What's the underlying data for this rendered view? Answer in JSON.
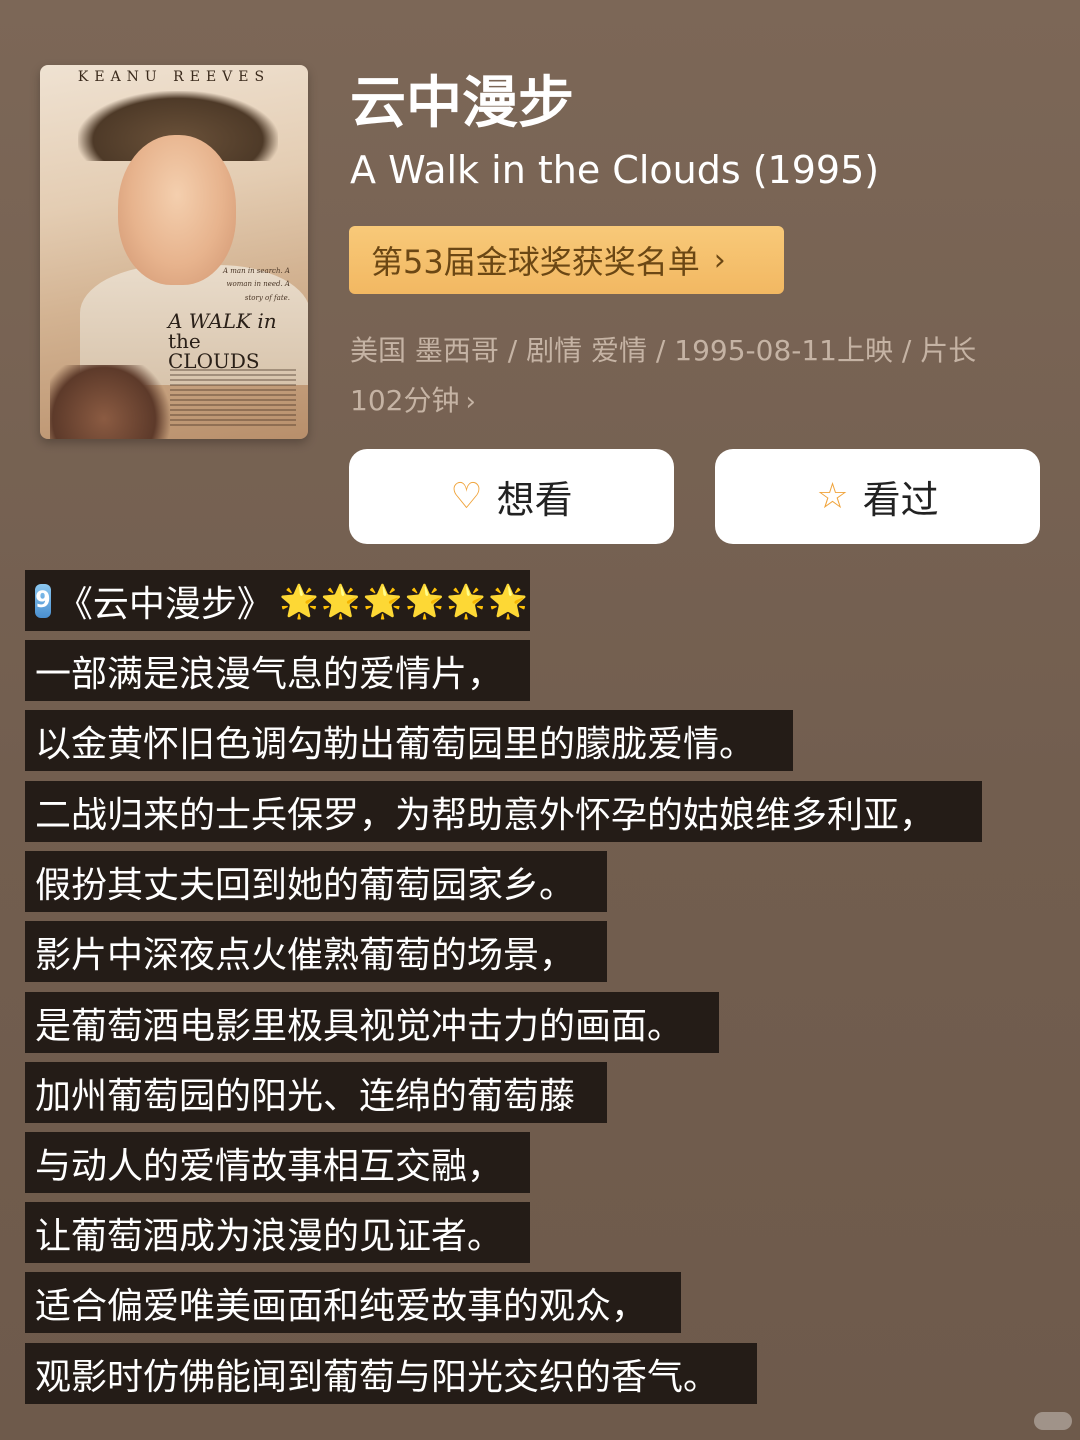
{
  "movie": {
    "poster": {
      "actor": "KEANU REEVES",
      "film_title_line1": "A WALK in",
      "film_title_line2": "the CLOUDS",
      "tagline": "A man in search. A woman in need. A story of fate."
    },
    "title_cn": "云中漫步",
    "title_en": "A Walk in the Clouds (1995)",
    "award": "第53届金球奖获奖名单",
    "meta_line1": "美国 墨西哥 / 剧情 爱情 / 1995-08-11上映 / 片长",
    "meta_line2": "102分钟",
    "buttons": {
      "want": "想看",
      "seen": "看过"
    },
    "icons": {
      "want": "heart-plus-icon",
      "seen": "star-outline-icon",
      "chevron": "chevron-right-icon"
    }
  },
  "review": {
    "number": "9",
    "headline": "《云中漫步》",
    "rating_stars": 6,
    "stars_text": "🌟🌟🌟🌟🌟🌟",
    "lines": [
      "一部满是浪漫气息的爱情片，",
      "以金黄怀旧色调勾勒出葡萄园里的朦胧爱情。",
      "二战归来的士兵保罗，为帮助意外怀孕的姑娘维多利亚，",
      "假扮其丈夫回到她的葡萄园家乡。",
      "影片中深夜点火催熟葡萄的场景，",
      "是葡萄酒电影里极具视觉冲击力的画面。",
      "加州葡萄园的阳光、连绵的葡萄藤",
      "与动人的爱情故事相互交融，",
      "让葡萄酒成为浪漫的见证者。",
      "适合偏爱唯美画面和纯爱故事的观众，",
      "观影时仿佛能闻到葡萄与阳光交织的香气。"
    ]
  },
  "colors": {
    "background": "#776252",
    "award_bg": "#f5c06c",
    "award_text": "#6b4714",
    "line_bg": "#241c17",
    "icon_accent": "#f0a43c",
    "meta_text": "#c5b3a4"
  }
}
